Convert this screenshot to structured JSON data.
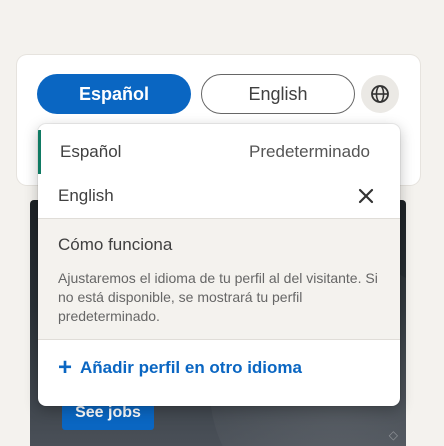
{
  "language_toggle": {
    "active_label": "Español",
    "inactive_label": "English"
  },
  "dropdown": {
    "rows": [
      {
        "label": "Español",
        "tag": "Predeterminado"
      },
      {
        "label": "English"
      }
    ],
    "info": {
      "title": "Cómo funciona",
      "body": "Ajustaremos el idioma de tu perfil al del visitante. Si no está disponible, se mostrará tu perfil predeterminado."
    },
    "add_label": "Añadir perfil en otro idioma"
  },
  "background": {
    "ad_button_label": "See jobs"
  },
  "colors": {
    "accent": "#0a66c2",
    "active_marker": "#0f7a63"
  },
  "icons": [
    "globe-icon",
    "close-icon",
    "plus-icon"
  ]
}
